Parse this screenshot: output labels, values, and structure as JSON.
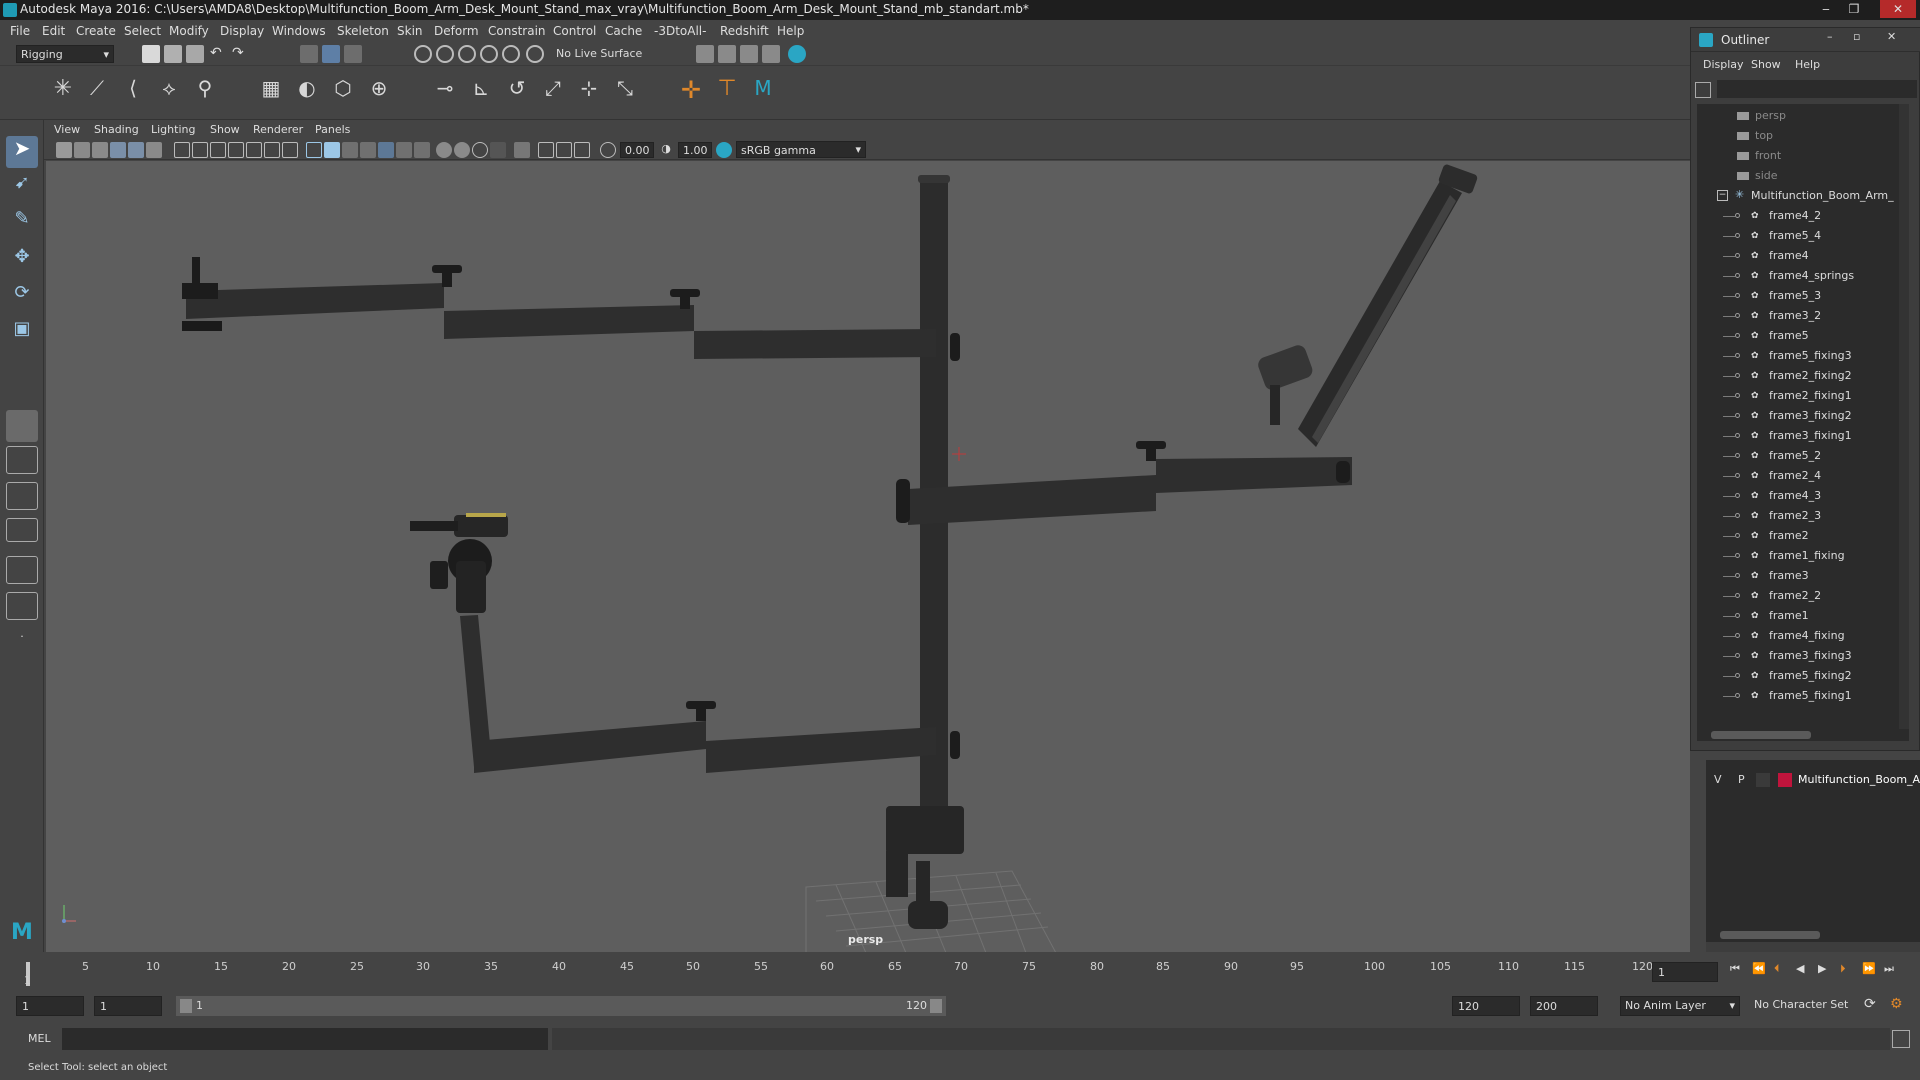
{
  "window": {
    "title": "Autodesk Maya 2016: C:\\Users\\AMDA8\\Desktop\\Multifunction_Boom_Arm_Desk_Mount_Stand_max_vray\\Multifunction_Boom_Arm_Desk_Mount_Stand_mb_standart.mb*",
    "minimize": "‒",
    "restore": "❐",
    "close": "✕"
  },
  "menubar": [
    "File",
    "Edit",
    "Create",
    "Select",
    "Modify",
    "Display",
    "Windows",
    "Skeleton",
    "Skin",
    "Deform",
    "Constrain",
    "Control",
    "Cache",
    "-3DtoAll-",
    "Redshift",
    "Help"
  ],
  "statusline": {
    "mode": "Rigging",
    "live_surface": "No Live Surface"
  },
  "viewport": {
    "menu": [
      "View",
      "Shading",
      "Lighting",
      "Show",
      "Renderer",
      "Panels"
    ],
    "exposure": "0.00",
    "gamma": "1.00",
    "color_space": "sRGB gamma",
    "camera_label": "persp"
  },
  "outliner": {
    "title": "Outliner",
    "menu": [
      "Display",
      "Show",
      "Help"
    ],
    "cameras": [
      "persp",
      "top",
      "front",
      "side"
    ],
    "group": "Multifunction_Boom_Arm_",
    "children": [
      "frame4_2",
      "frame5_4",
      "frame4",
      "frame4_springs",
      "frame5_3",
      "frame3_2",
      "frame5",
      "frame5_fixing3",
      "frame2_fixing2",
      "frame2_fixing1",
      "frame3_fixing2",
      "frame3_fixing1",
      "frame5_2",
      "frame2_4",
      "frame4_3",
      "frame2_3",
      "frame2",
      "frame1_fixing",
      "frame3",
      "frame2_2",
      "frame1",
      "frame4_fixing",
      "frame3_fixing3",
      "frame5_fixing2",
      "frame5_fixing1"
    ]
  },
  "layers": {
    "v": "V",
    "p": "P",
    "name": "Multifunction_Boom_A",
    "color": "#c0143c"
  },
  "timeline": {
    "ticks": [
      "5",
      "10",
      "15",
      "20",
      "25",
      "30",
      "35",
      "40",
      "45",
      "50",
      "55",
      "60",
      "65",
      "70",
      "75",
      "80",
      "85",
      "90",
      "95",
      "100",
      "105",
      "110",
      "115",
      "120"
    ],
    "current_frame_marker": "1",
    "current_frame": "1"
  },
  "range": {
    "start": "1",
    "anim_start": "1",
    "slider_start": "1",
    "slider_end": "120",
    "playback_end": "120",
    "anim_end": "200",
    "anim_layer": "No Anim Layer",
    "character_set": "No Character Set"
  },
  "command": {
    "label": "MEL"
  },
  "help_line": "Select Tool: select an object",
  "colors": {
    "accent": "#1f9bb5",
    "viewport_bg": "#5e5e5e",
    "model": "#2c2c2c",
    "shelf_orange": "#e0882a"
  }
}
